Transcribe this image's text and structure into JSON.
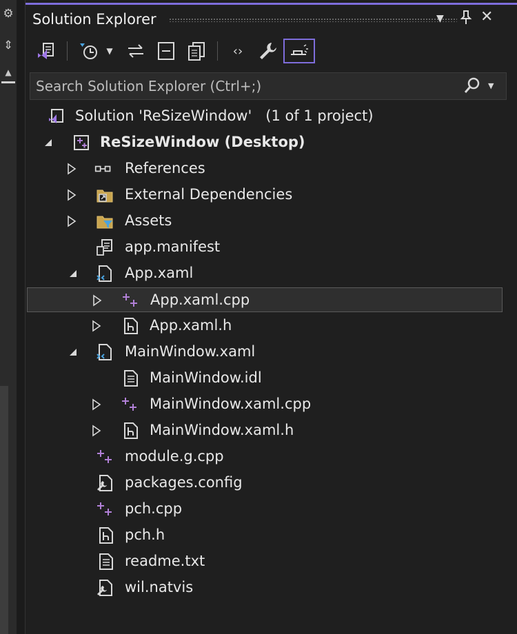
{
  "window": {
    "title": "Solution Explorer"
  },
  "search": {
    "placeholder": "Search Solution Explorer (Ctrl+;)"
  },
  "tree": {
    "solution": {
      "label": "Solution 'ReSizeWindow'",
      "suffix": "(1 of 1 project)"
    },
    "project": "ReSizeWindow (Desktop)",
    "items": {
      "references": "References",
      "external_dependencies": "External Dependencies",
      "assets": "Assets",
      "app_manifest": "app.manifest",
      "app_xaml": "App.xaml",
      "app_xaml_cpp": "App.xaml.cpp",
      "app_xaml_h": "App.xaml.h",
      "mainwindow_xaml": "MainWindow.xaml",
      "mainwindow_idl": "MainWindow.idl",
      "mainwindow_xaml_cpp": "MainWindow.xaml.cpp",
      "mainwindow_xaml_h": "MainWindow.xaml.h",
      "module_g_cpp": "module.g.cpp",
      "packages_config": "packages.config",
      "pch_cpp": "pch.cpp",
      "pch_h": "pch.h",
      "readme_txt": "readme.txt",
      "wil_natvis": "wil.natvis"
    }
  },
  "colors": {
    "accent": "#7e6ddb",
    "background": "#1f1f1f",
    "selection": "#2f2f2f",
    "cpp_plus": "#b180d7"
  }
}
